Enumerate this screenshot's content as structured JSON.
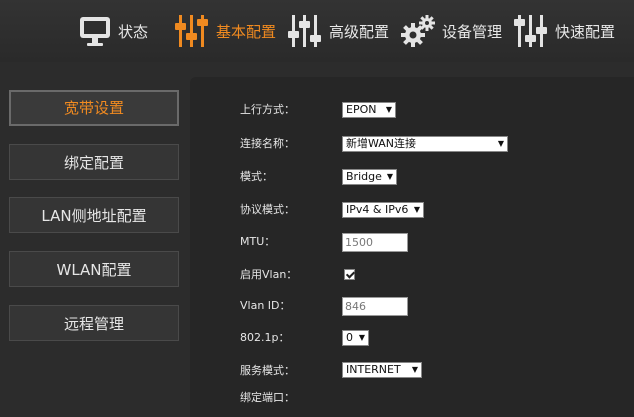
{
  "nav": {
    "items": [
      {
        "label": "状态",
        "icon": "monitor-icon"
      },
      {
        "label": "基本配置",
        "icon": "sliders-icon"
      },
      {
        "label": "高级配置",
        "icon": "advanced-sliders-icon"
      },
      {
        "label": "设备管理",
        "icon": "gears-icon"
      },
      {
        "label": "快速配置",
        "icon": "quick-sliders-icon"
      }
    ],
    "active_index": 1,
    "accent_color": "#f08a20"
  },
  "sidebar": {
    "items": [
      {
        "label": "宽带设置"
      },
      {
        "label": "绑定配置"
      },
      {
        "label": "LAN侧地址配置"
      },
      {
        "label": "WLAN配置"
      },
      {
        "label": "远程管理"
      }
    ],
    "active_index": 0
  },
  "form": {
    "uplink_mode": {
      "label": "上行方式：",
      "value": "EPON"
    },
    "connection_name": {
      "label": "连接名称：",
      "value": "新增WAN连接"
    },
    "mode": {
      "label": "模式：",
      "value": "Bridge"
    },
    "protocol_mode": {
      "label": "协议模式：",
      "value": "IPv4 & IPv6"
    },
    "mtu": {
      "label": "MTU：",
      "value": "1500"
    },
    "enable_vlan": {
      "label": "启用Vlan：",
      "checked": true
    },
    "vlan_id": {
      "label": "Vlan ID：",
      "value": "846"
    },
    "priority_8021p": {
      "label": "802.1p：",
      "value": "0"
    },
    "service_mode": {
      "label": "服务模式：",
      "value": "INTERNET"
    },
    "bind_port": {
      "label": "绑定端口："
    }
  }
}
